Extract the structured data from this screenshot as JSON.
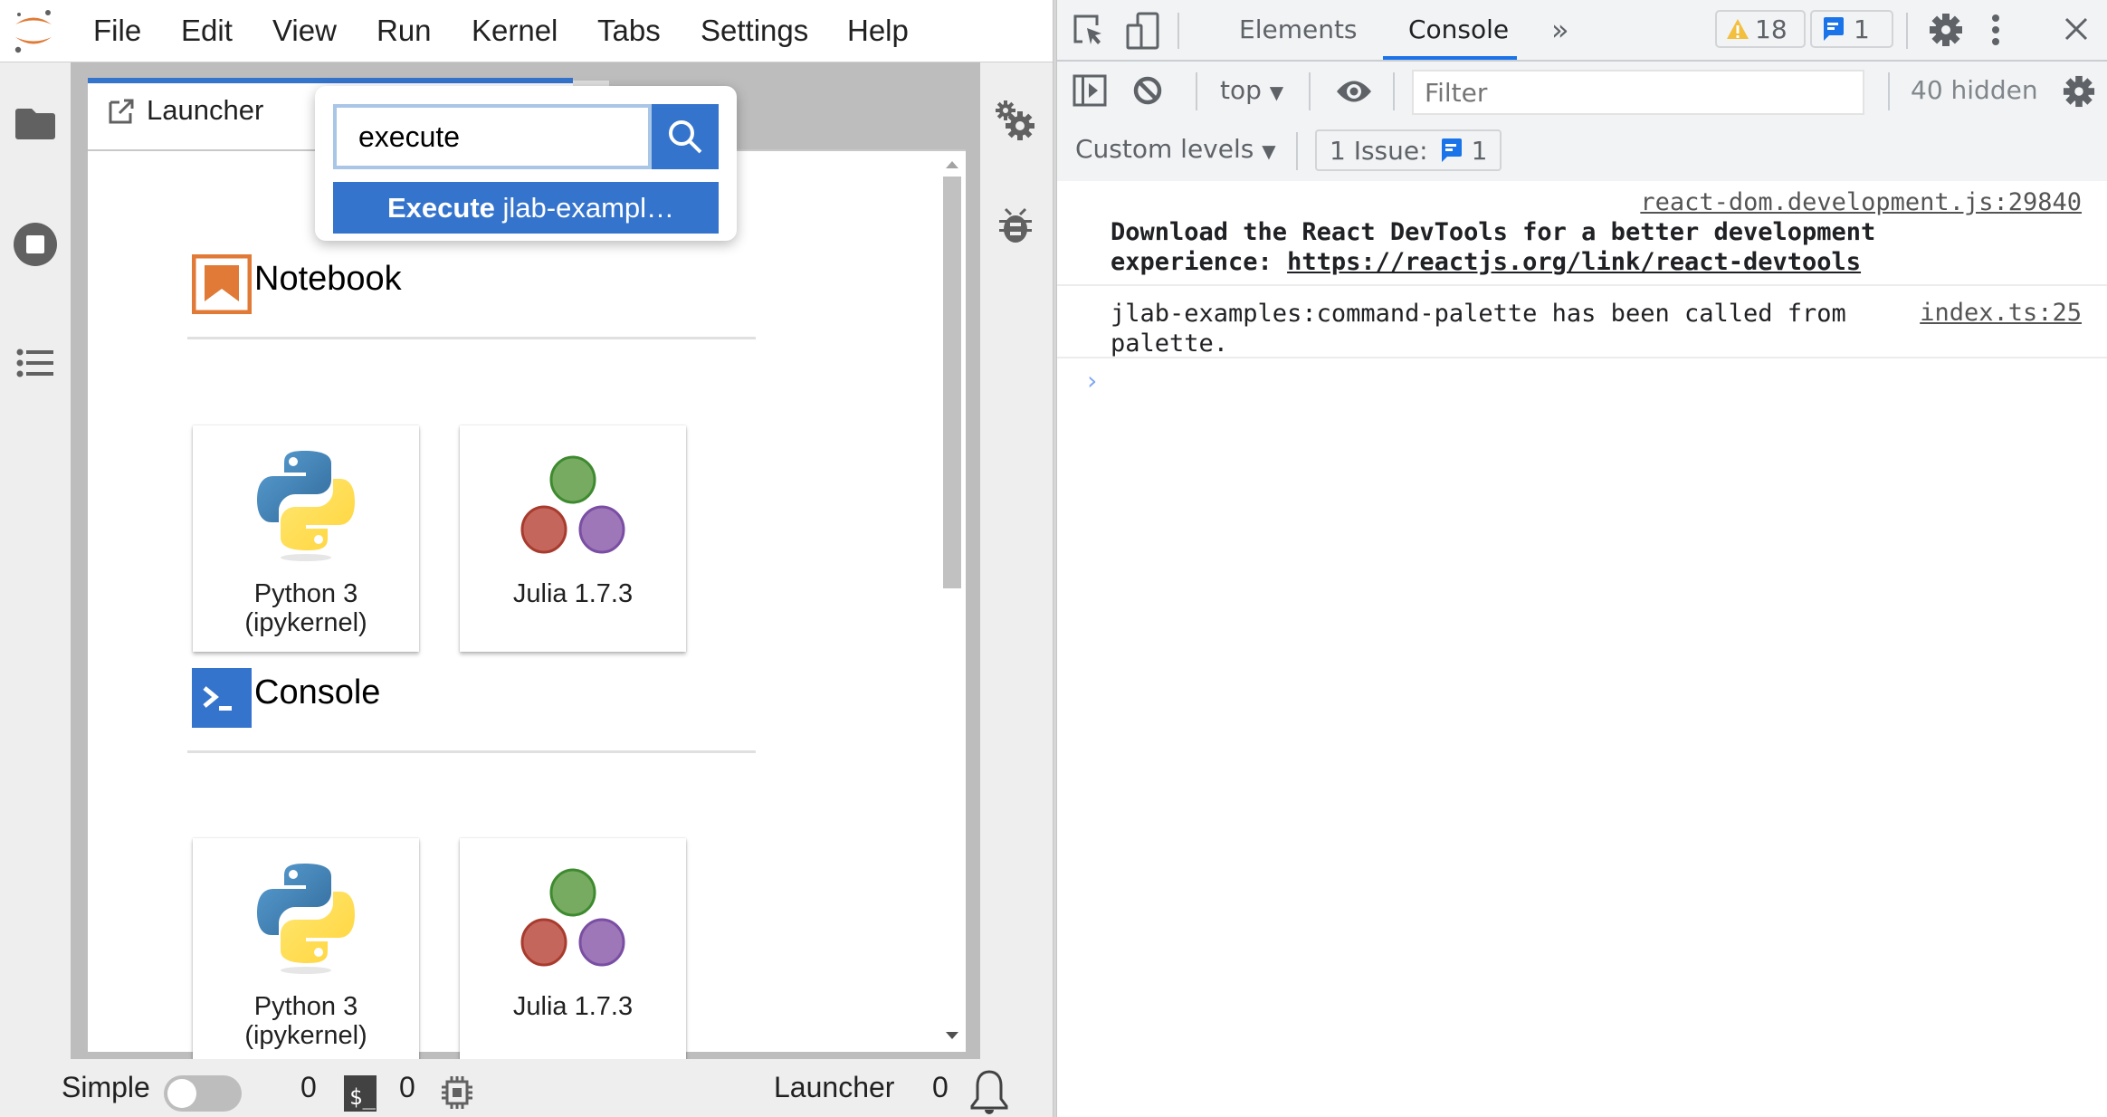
{
  "jupyterlab": {
    "menu": [
      "File",
      "Edit",
      "View",
      "Run",
      "Kernel",
      "Tabs",
      "Settings",
      "Help"
    ],
    "left_sidebar": [
      {
        "icon": "folder-icon",
        "label": "File Browser"
      },
      {
        "icon": "stop-circle-icon",
        "label": "Running Terminals and Kernels"
      },
      {
        "icon": "list-icon",
        "label": "Table of Contents"
      }
    ],
    "right_sidebar": [
      {
        "icon": "property-inspector-icon",
        "label": "Property Inspector"
      },
      {
        "icon": "bug-icon",
        "label": "Debugger"
      }
    ],
    "tab": {
      "label": "Launcher",
      "icon": "launcher-icon"
    },
    "command_palette": {
      "query": "execute",
      "placeholder": "SEARCH",
      "result_match": "Execute",
      "result_rest": " jlab-exampl…"
    },
    "launcher": {
      "sections": [
        {
          "title": "Notebook",
          "icon": "notebook-icon",
          "color": "#e07a36",
          "cards": [
            {
              "label_line1": "Python 3",
              "label_line2": "(ipykernel)",
              "logo": "python-logo"
            },
            {
              "label_line1": "Julia 1.7.3",
              "label_line2": "",
              "logo": "julia-logo"
            }
          ]
        },
        {
          "title": "Console",
          "icon": "console-icon",
          "color": "#3574cc",
          "cards": [
            {
              "label_line1": "Python 3",
              "label_line2": "(ipykernel)",
              "logo": "python-logo"
            },
            {
              "label_line1": "Julia 1.7.3",
              "label_line2": "",
              "logo": "julia-logo"
            }
          ]
        }
      ]
    },
    "statusbar": {
      "simple_label": "Simple",
      "simple_enabled": false,
      "kernels_count": "0",
      "terminals_count": "0",
      "active_label": "Launcher",
      "notifications_count": "0"
    }
  },
  "devtools": {
    "tabs": [
      "Elements",
      "Console"
    ],
    "active_tab": "Console",
    "more_tabs_label": "»",
    "warnings_count": "18",
    "messages_count": "1",
    "context": "top",
    "filter_placeholder": "Filter",
    "hidden_label": "40 hidden",
    "levels_label": "Custom levels",
    "issues_label": "1 Issue:",
    "issues_count": "1",
    "messages": [
      {
        "source": "react-dom.development.js:29840",
        "line1": "Download the React DevTools for a better development",
        "line2_prefix": "experience: ",
        "line2_link": "https://reactjs.org/link/react-devtools",
        "bold": true
      },
      {
        "source": "index.ts:25",
        "line1": "jlab-examples:command-palette has been called from",
        "line2_prefix": "palette.",
        "line2_link": "",
        "bold": false
      }
    ],
    "prompt_caret": "›"
  },
  "colors": {
    "jupyter_blue": "#3574cc",
    "jupyter_orange": "#e07a36",
    "devtools_blue": "#1a73e8",
    "warning_yellow": "#f2bf3e"
  }
}
